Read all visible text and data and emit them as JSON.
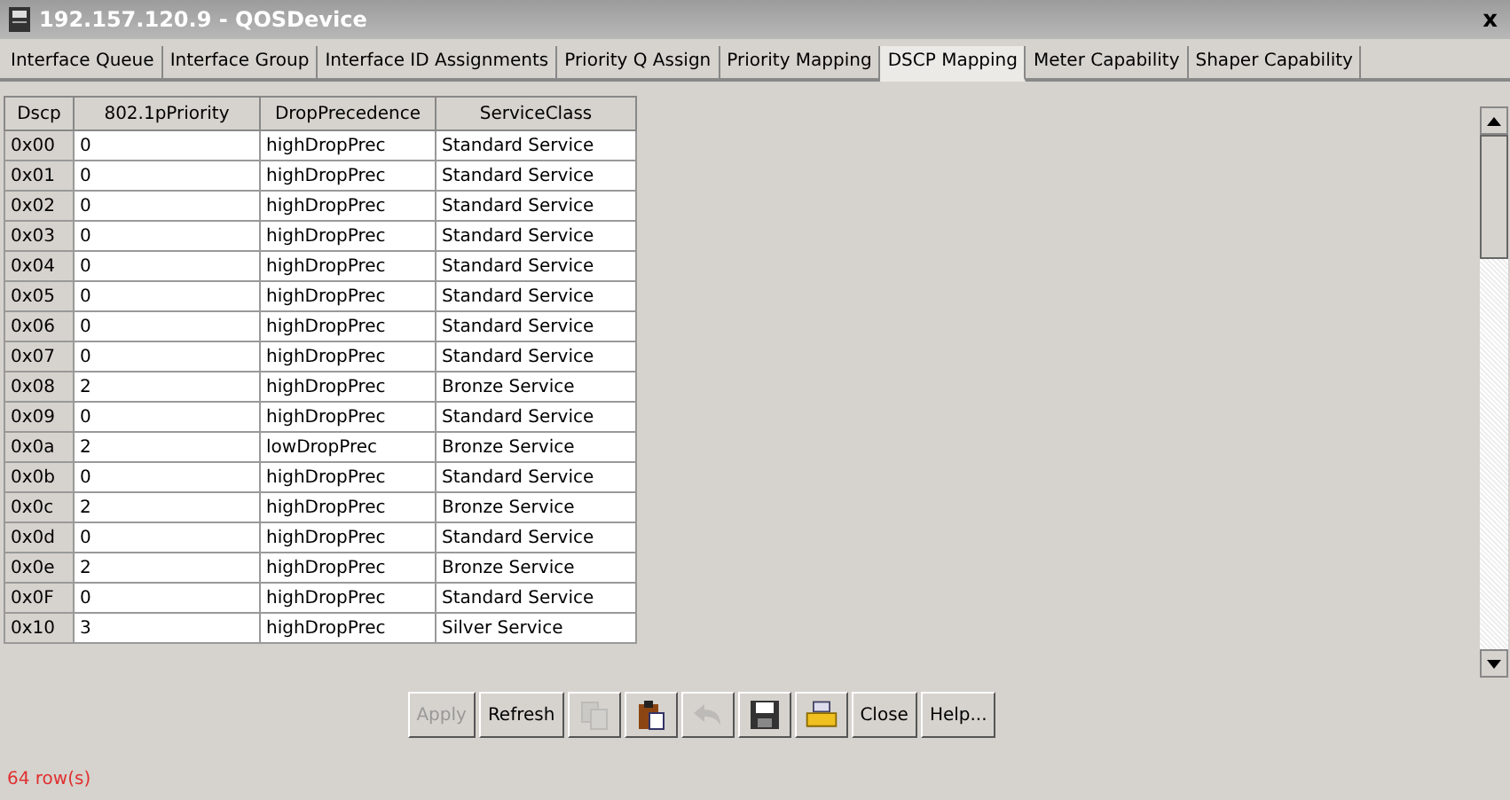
{
  "window": {
    "title": "192.157.120.9 - QOSDevice",
    "close": "x"
  },
  "tabs": [
    {
      "label": "Interface Queue",
      "selected": false
    },
    {
      "label": "Interface Group",
      "selected": false
    },
    {
      "label": "Interface ID Assignments",
      "selected": false
    },
    {
      "label": "Priority Q Assign",
      "selected": false
    },
    {
      "label": "Priority Mapping",
      "selected": false
    },
    {
      "label": "DSCP Mapping",
      "selected": true
    },
    {
      "label": "Meter Capability",
      "selected": false
    },
    {
      "label": "Shaper Capability",
      "selected": false
    }
  ],
  "table": {
    "columns": [
      "Dscp",
      "802.1pPriority",
      "DropPrecedence",
      "ServiceClass"
    ],
    "rows": [
      [
        "0x00",
        "0",
        "highDropPrec",
        "Standard Service"
      ],
      [
        "0x01",
        "0",
        "highDropPrec",
        "Standard Service"
      ],
      [
        "0x02",
        "0",
        "highDropPrec",
        "Standard Service"
      ],
      [
        "0x03",
        "0",
        "highDropPrec",
        "Standard Service"
      ],
      [
        "0x04",
        "0",
        "highDropPrec",
        "Standard Service"
      ],
      [
        "0x05",
        "0",
        "highDropPrec",
        "Standard Service"
      ],
      [
        "0x06",
        "0",
        "highDropPrec",
        "Standard Service"
      ],
      [
        "0x07",
        "0",
        "highDropPrec",
        "Standard Service"
      ],
      [
        "0x08",
        "2",
        "highDropPrec",
        "Bronze Service"
      ],
      [
        "0x09",
        "0",
        "highDropPrec",
        "Standard Service"
      ],
      [
        "0x0a",
        "2",
        "lowDropPrec",
        "Bronze Service"
      ],
      [
        "0x0b",
        "0",
        "highDropPrec",
        "Standard Service"
      ],
      [
        "0x0c",
        "2",
        "highDropPrec",
        "Bronze Service"
      ],
      [
        "0x0d",
        "0",
        "highDropPrec",
        "Standard Service"
      ],
      [
        "0x0e",
        "2",
        "highDropPrec",
        "Bronze Service"
      ],
      [
        "0x0F",
        "0",
        "highDropPrec",
        "Standard Service"
      ],
      [
        "0x10",
        "3",
        "highDropPrec",
        "Silver Service"
      ]
    ]
  },
  "buttons": [
    {
      "kind": "text",
      "label": "Apply",
      "disabled": true
    },
    {
      "kind": "text",
      "label": "Refresh",
      "disabled": false
    },
    {
      "kind": "copy",
      "disabled": true
    },
    {
      "kind": "paste",
      "disabled": false
    },
    {
      "kind": "undo",
      "disabled": true
    },
    {
      "kind": "save",
      "disabled": false
    },
    {
      "kind": "print",
      "disabled": false
    },
    {
      "kind": "text",
      "label": "Close",
      "disabled": false
    },
    {
      "kind": "text",
      "label": "Help...",
      "disabled": false
    }
  ],
  "status_bar": "64 row(s)"
}
